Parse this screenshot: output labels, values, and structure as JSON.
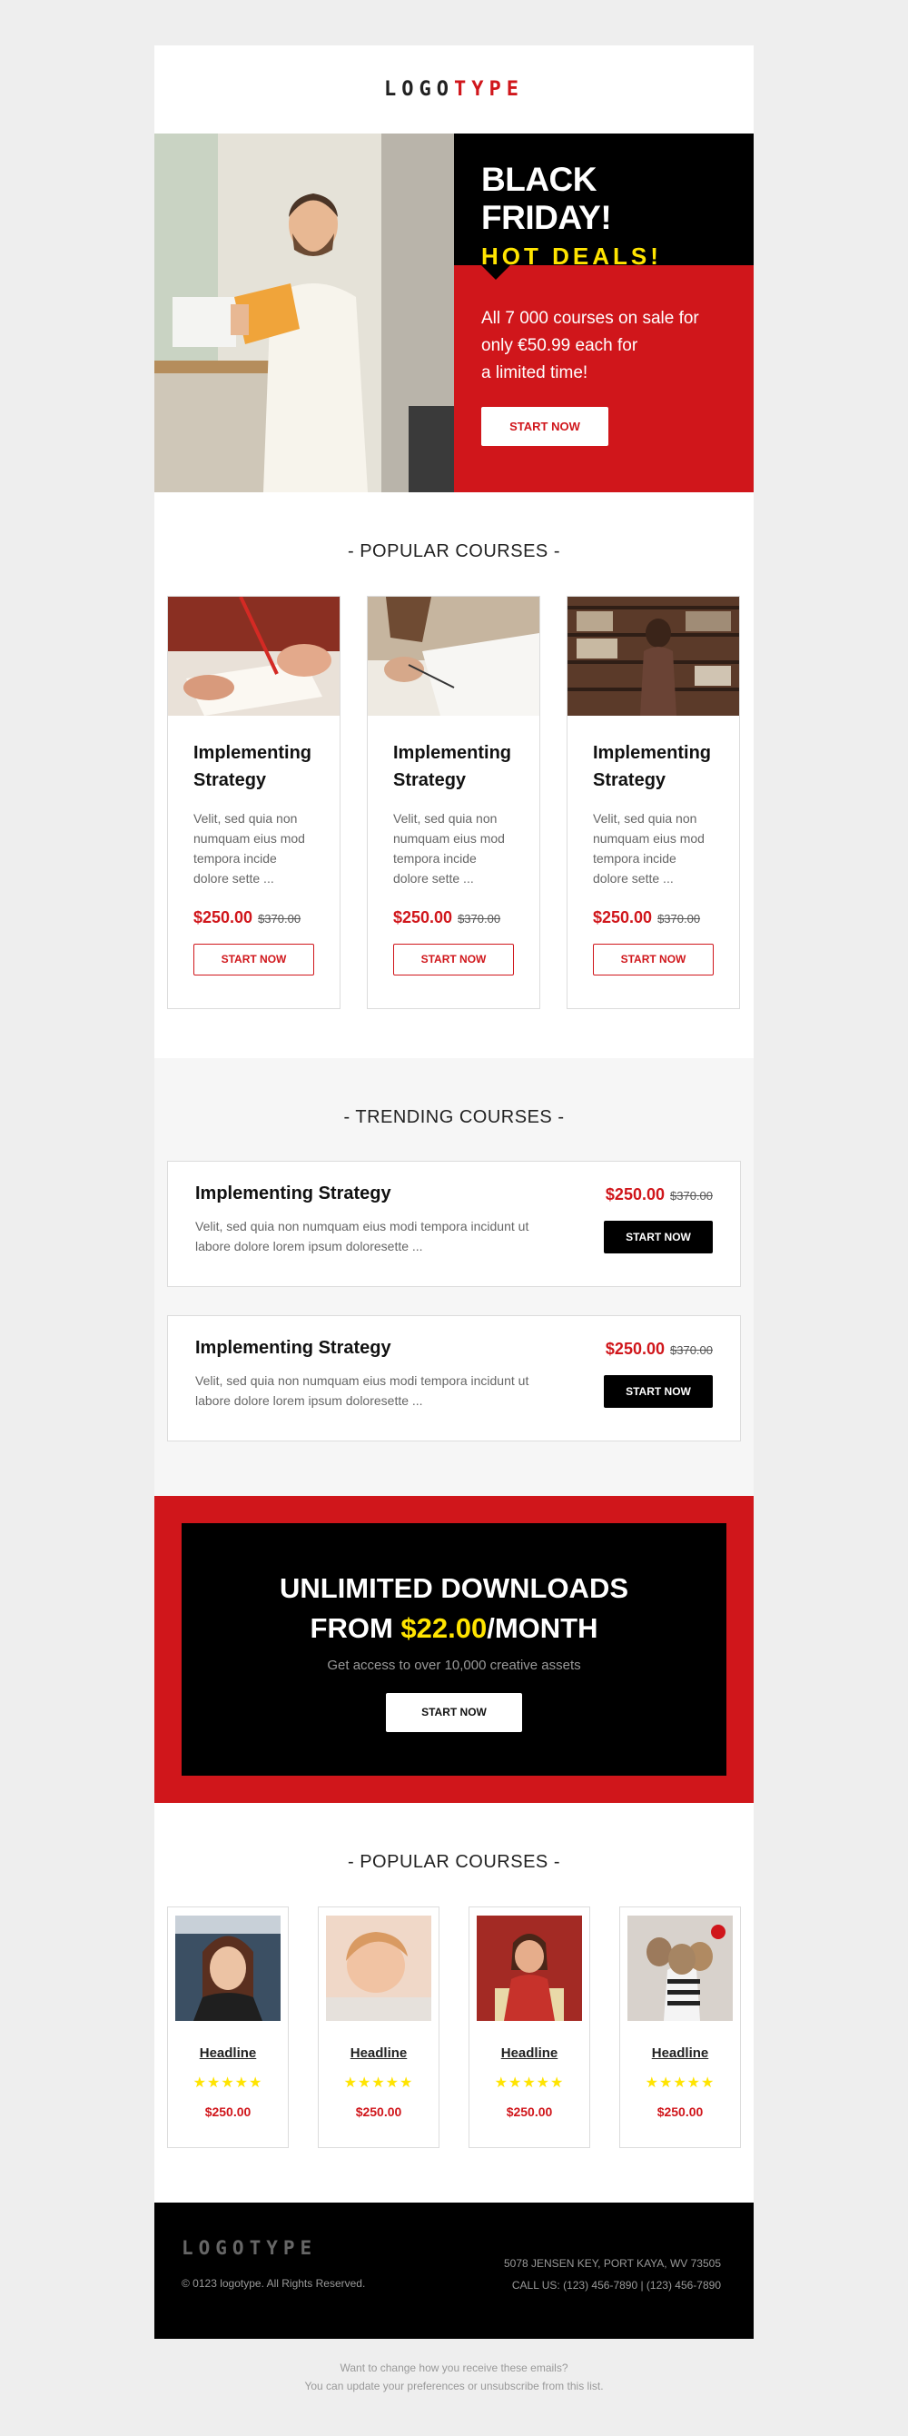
{
  "header": {
    "logo_part1": "LOGO",
    "logo_part2": "TYPE"
  },
  "hero": {
    "title": "BLACK FRIDAY!",
    "subtitle": "HOT DEALS!",
    "body_line1": "All 7 000 courses on sale for",
    "body_line2": "only €50.99 each for",
    "body_line3": "a limited time!",
    "cta": "START NOW"
  },
  "popular1": {
    "title": "- POPULAR COURSES -",
    "cards": [
      {
        "title_l1": "Implementing",
        "title_l2": "Strategy",
        "desc": "Velit, sed quia non numquam eius mod tempora incide dolore sette ...",
        "price": "$250.00",
        "old_price": "$370.00",
        "cta": "START NOW"
      },
      {
        "title_l1": "Implementing",
        "title_l2": "Strategy",
        "desc": "Velit, sed quia non numquam eius mod tempora incide dolore sette ...",
        "price": "$250.00",
        "old_price": "$370.00",
        "cta": "START NOW"
      },
      {
        "title_l1": "Implementing",
        "title_l2": "Strategy",
        "desc": "Velit, sed quia non numquam eius mod tempora incide dolore sette ...",
        "price": "$250.00",
        "old_price": "$370.00",
        "cta": "START NOW"
      }
    ]
  },
  "trending": {
    "title": "- TRENDING COURSES -",
    "rows": [
      {
        "title": "Implementing Strategy",
        "desc": "Velit, sed quia non numquam eius modi tempora incidunt ut labore dolore lorem ipsum doloresette ...",
        "price": "$250.00",
        "old_price": "$370.00",
        "cta": "START NOW"
      },
      {
        "title": "Implementing Strategy",
        "desc": "Velit, sed quia non numquam eius modi tempora incidunt ut labore dolore lorem ipsum doloresette ...",
        "price": "$250.00",
        "old_price": "$370.00",
        "cta": "START NOW"
      }
    ]
  },
  "promo": {
    "line1": "UNLIMITED DOWNLOADS",
    "line2_prefix": "FROM ",
    "line2_price": "$22.00",
    "line2_suffix": "/MONTH",
    "sub": "Get access to over 10,000 creative assets",
    "cta": "START NOW"
  },
  "popular2": {
    "title": "- POPULAR COURSES -",
    "cards": [
      {
        "headline": "Headline",
        "stars": "★★★★★",
        "price": "$250.00"
      },
      {
        "headline": "Headline",
        "stars": "★★★★★",
        "price": "$250.00"
      },
      {
        "headline": "Headline",
        "stars": "★★★★★",
        "price": "$250.00"
      },
      {
        "headline": "Headline",
        "stars": "★★★★★",
        "price": "$250.00"
      }
    ]
  },
  "footer": {
    "logo": "LOGOTYPE",
    "copyright": "© 0123 logotype. All Rights Reserved.",
    "address": "5078 JENSEN KEY, PORT KAYA, WV 73505",
    "phone": "CALL US: (123) 456-7890  |  (123) 456-7890"
  },
  "bottom": {
    "line1": "Want to change how you receive these emails?",
    "line2": "You can update your preferences or unsubscribe from this list."
  },
  "colors": {
    "accent": "#d0161b",
    "highlight": "#ffe400",
    "dark": "#000000"
  }
}
